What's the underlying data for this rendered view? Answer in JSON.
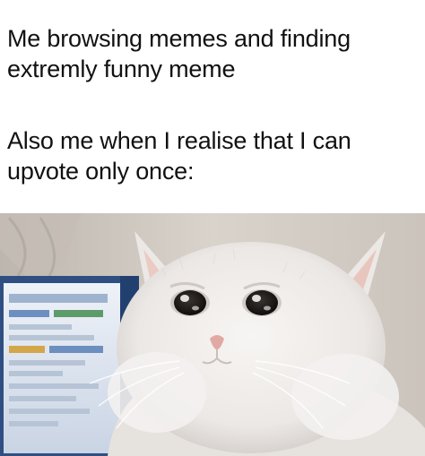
{
  "caption_top": {
    "line1": "Me browsing memes and finding",
    "line2": "extremly funny meme"
  },
  "caption_bottom": {
    "line1": "Also me when I realise that I can",
    "line2": "upvote only once:"
  },
  "image": {
    "subject": "crying-cat",
    "colors": {
      "background_wall": "#d9d3cc",
      "monitor_frame": "#3a5a8c",
      "monitor_screen": "#e8eef6",
      "cat_fur": "#f2f0ee",
      "cat_shadow": "#cfcac6",
      "eye_dark": "#1a1716",
      "ear_pink": "#e7b8ad",
      "nose_pink": "#e2a9a2"
    }
  }
}
